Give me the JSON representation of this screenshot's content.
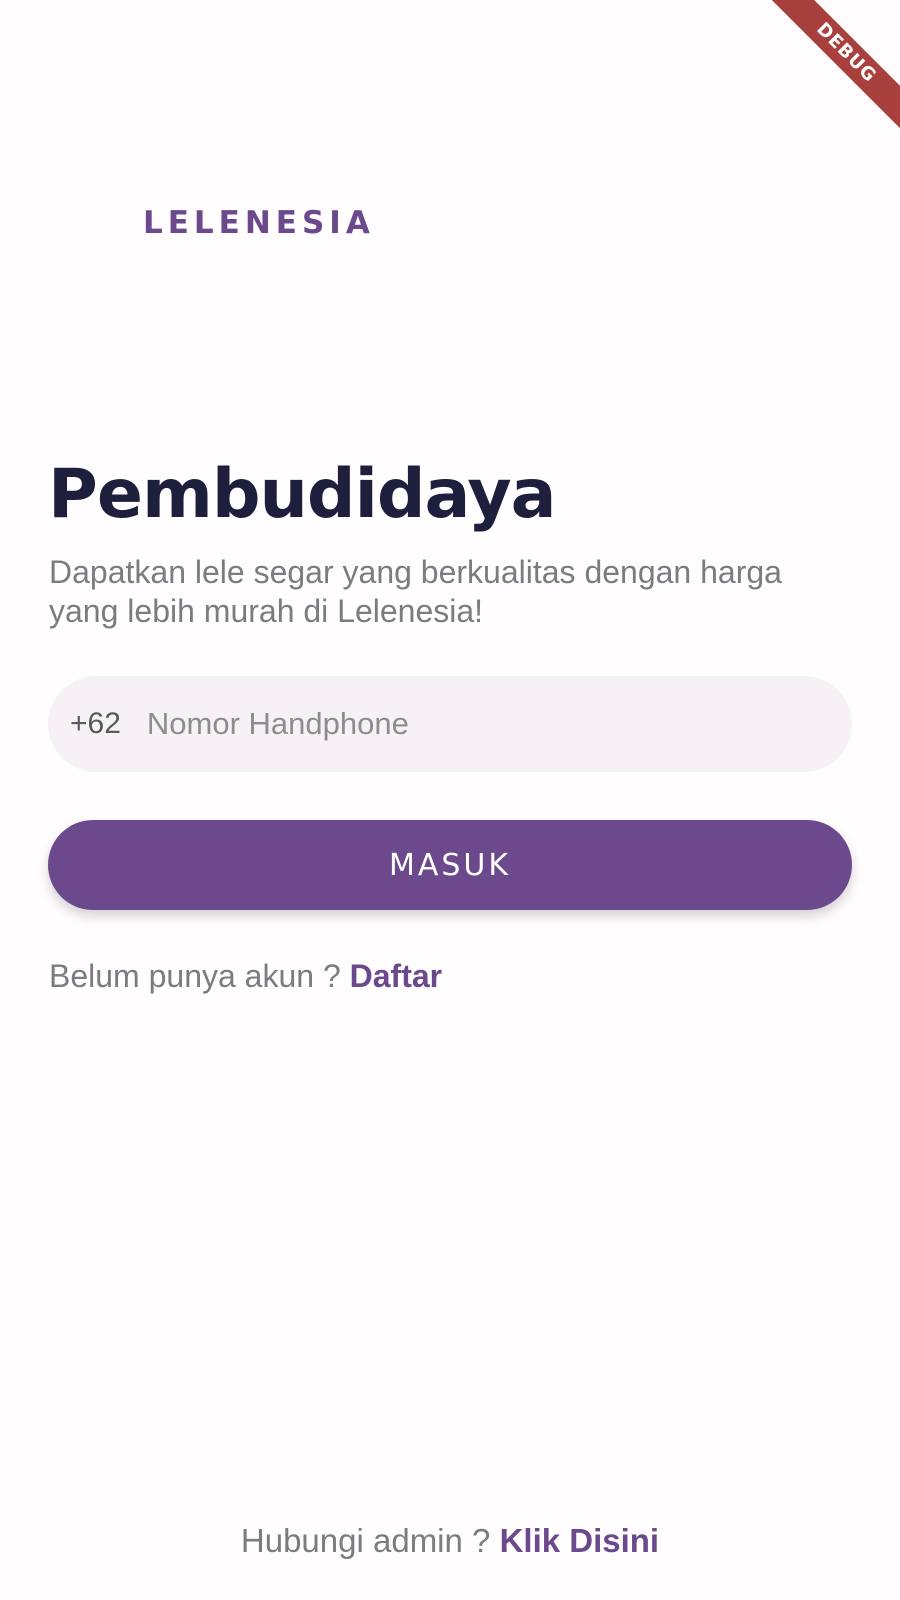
{
  "app": {
    "brand": "LELENESIA",
    "debug_banner": "DEBUG"
  },
  "login": {
    "title": "Pembudidaya",
    "subtitle": "Dapatkan lele segar yang berkualitas dengan harga yang lebih murah di Lelenesia!",
    "phone_prefix": "+62",
    "phone_placeholder": "Nomor Handphone",
    "phone_value": "",
    "submit_label": "MASUK"
  },
  "register": {
    "prompt": "Belum punya akun ? ",
    "link_label": "Daftar"
  },
  "admin": {
    "prompt": "Hubungi admin ? ",
    "link_label": "Klik Disini"
  },
  "colors": {
    "brand": "#6b498c",
    "title": "#1e1f3d",
    "muted_text": "#7b7b82",
    "input_bg": "#f6f1f5",
    "debug_ribbon": "#a8413e"
  }
}
